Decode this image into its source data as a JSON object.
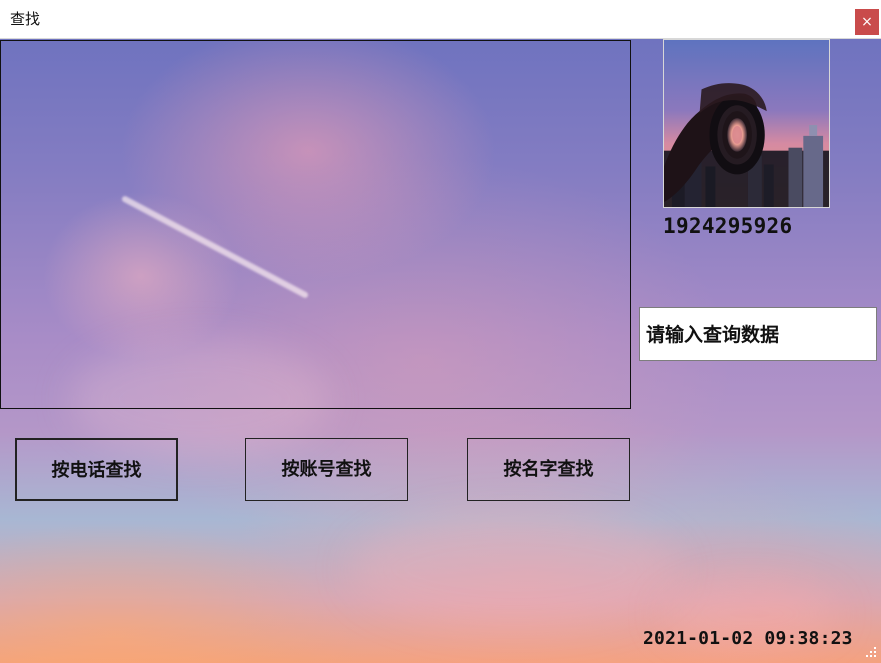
{
  "window": {
    "title": "查找",
    "close_label": "×"
  },
  "profile": {
    "account_number": "1924295926",
    "avatar_icon": "camera-lens-city-icon"
  },
  "search": {
    "placeholder": "请输入查询数据"
  },
  "buttons": {
    "phone": "按电话查找",
    "account": "按账号查找",
    "name": "按名字查找"
  },
  "status": {
    "clock": "2021-01-02  09:38:23"
  },
  "colors": {
    "close": "#c94b4b",
    "sky_blue": "#6f73bf",
    "sky_pink": "#f3a37c"
  }
}
